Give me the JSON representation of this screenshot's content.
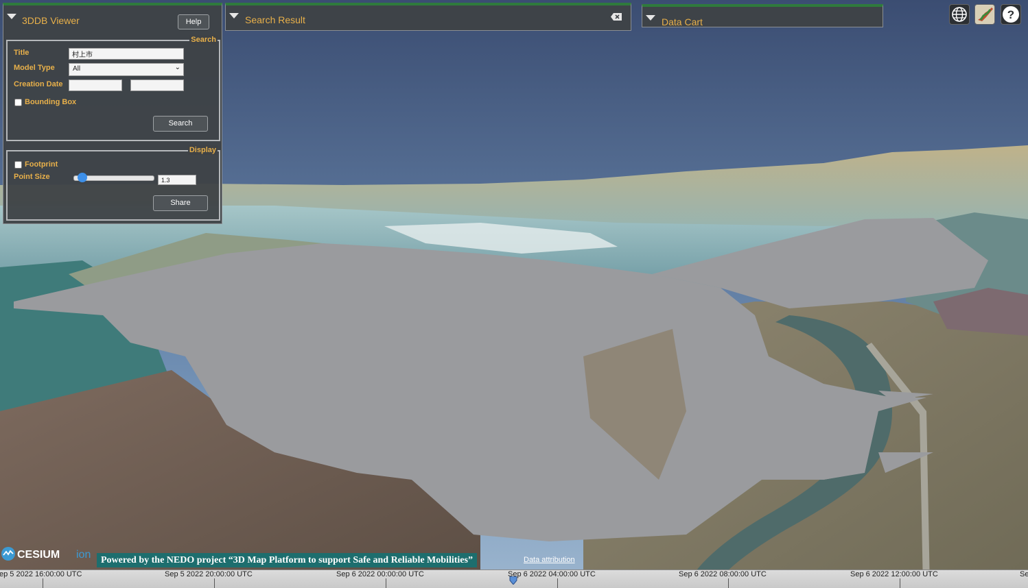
{
  "viewer": {
    "title": "3DDB Viewer",
    "help_label": "Help",
    "search_legend": "Search",
    "title_label": "Title",
    "title_value": "村上市",
    "model_type_label": "Model Type",
    "model_type_value": "All",
    "creation_date_label": "Creation Date",
    "date_from_value": "",
    "date_to_value": "",
    "bounding_box_label": "Bounding Box",
    "search_button": "Search",
    "display_legend": "Display",
    "footprint_label": "Footprint",
    "point_size_label": "Point Size",
    "point_size_value": "1.3",
    "point_size_slider_fraction": 0.05,
    "share_button": "Share"
  },
  "search_result": {
    "title": "Search Result"
  },
  "data_cart": {
    "title": "Data Cart"
  },
  "toolbar": {
    "icons": [
      "globe-icon",
      "map-layer-icon",
      "help-icon"
    ]
  },
  "credits": {
    "cesium_logo": "CESIUM ion",
    "nedo": "Powered by the NEDO project “3D Map Platform to support Safe and Reliable Mobilities”",
    "attribution": "Data attribution"
  },
  "timeline": {
    "labels": [
      "ep 5 2022 16:00:00 UTC",
      "Sep 5 2022 20:00:00 UTC",
      "Sep 6 2022 00:00:00 UTC",
      "Sep 6 2022 04:00:00 UTC",
      "Sep 6 2022 08:00:00 UTC",
      "Sep 6 2022 12:00:00 UTC",
      "Se"
    ]
  },
  "colors": {
    "panel_accent": "#2f7a3c",
    "title_gold": "#e8b04a",
    "nedo_banner": "#1d6e6e"
  }
}
